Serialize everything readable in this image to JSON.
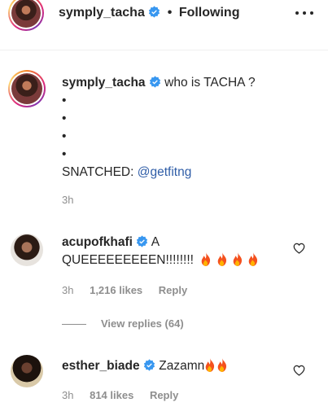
{
  "header": {
    "username": "symply_tacha",
    "dot": "•",
    "follow_status": "Following"
  },
  "caption": {
    "username": "symply_tacha",
    "text": "who is TACHA ?",
    "bullets": [
      "•",
      "•",
      "•",
      "•"
    ],
    "snatched_label": "SNATCHED:",
    "mention": "@getfitng",
    "time": "3h"
  },
  "comments": [
    {
      "username": "acupofkhafi",
      "text_line1": "A",
      "text_line2": "QUEEEEEEEEEN!!!!!!!!",
      "emoji": "fire x4",
      "time": "3h",
      "likes": "1,216 likes",
      "reply_label": "Reply"
    },
    {
      "username": "esther_biade",
      "text": "Zazamn",
      "emoji": "fire x2",
      "time": "3h",
      "likes": "814 likes",
      "reply_label": "Reply"
    }
  ],
  "view_replies": "View replies (64)",
  "colors": {
    "text": "#262626",
    "muted": "#8e8e8e",
    "verified": "#3897f0",
    "link": "#2f5da7"
  },
  "icons": [
    "verified-badge-icon",
    "more-options-icon",
    "heart-icon",
    "fire-emoji-icon"
  ]
}
